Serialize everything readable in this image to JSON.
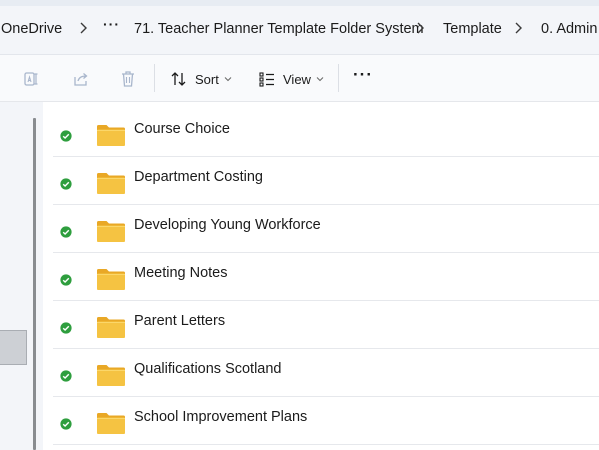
{
  "breadcrumb": {
    "items": [
      "OneDrive",
      "71. Teacher Planner Template Folder System",
      "Template",
      "0. Admin"
    ],
    "overflow_label": "···"
  },
  "toolbar": {
    "icons": [
      "rename-icon",
      "share-icon",
      "delete-icon"
    ],
    "sort_label": "Sort",
    "view_label": "View",
    "more_label": "···"
  },
  "files": [
    {
      "name": "Course Choice",
      "status": "synced"
    },
    {
      "name": "Department Costing",
      "status": "synced"
    },
    {
      "name": "Developing Young Workforce",
      "status": "synced"
    },
    {
      "name": "Meeting Notes",
      "status": "synced"
    },
    {
      "name": "Parent Letters",
      "status": "synced"
    },
    {
      "name": "Qualifications Scotland",
      "status": "synced"
    },
    {
      "name": "School Improvement Plans",
      "status": "synced"
    }
  ],
  "colors": {
    "synced": "#2e9e3e",
    "folder": "#f5c342",
    "toolbar_disabled": "#a9b6cc"
  }
}
